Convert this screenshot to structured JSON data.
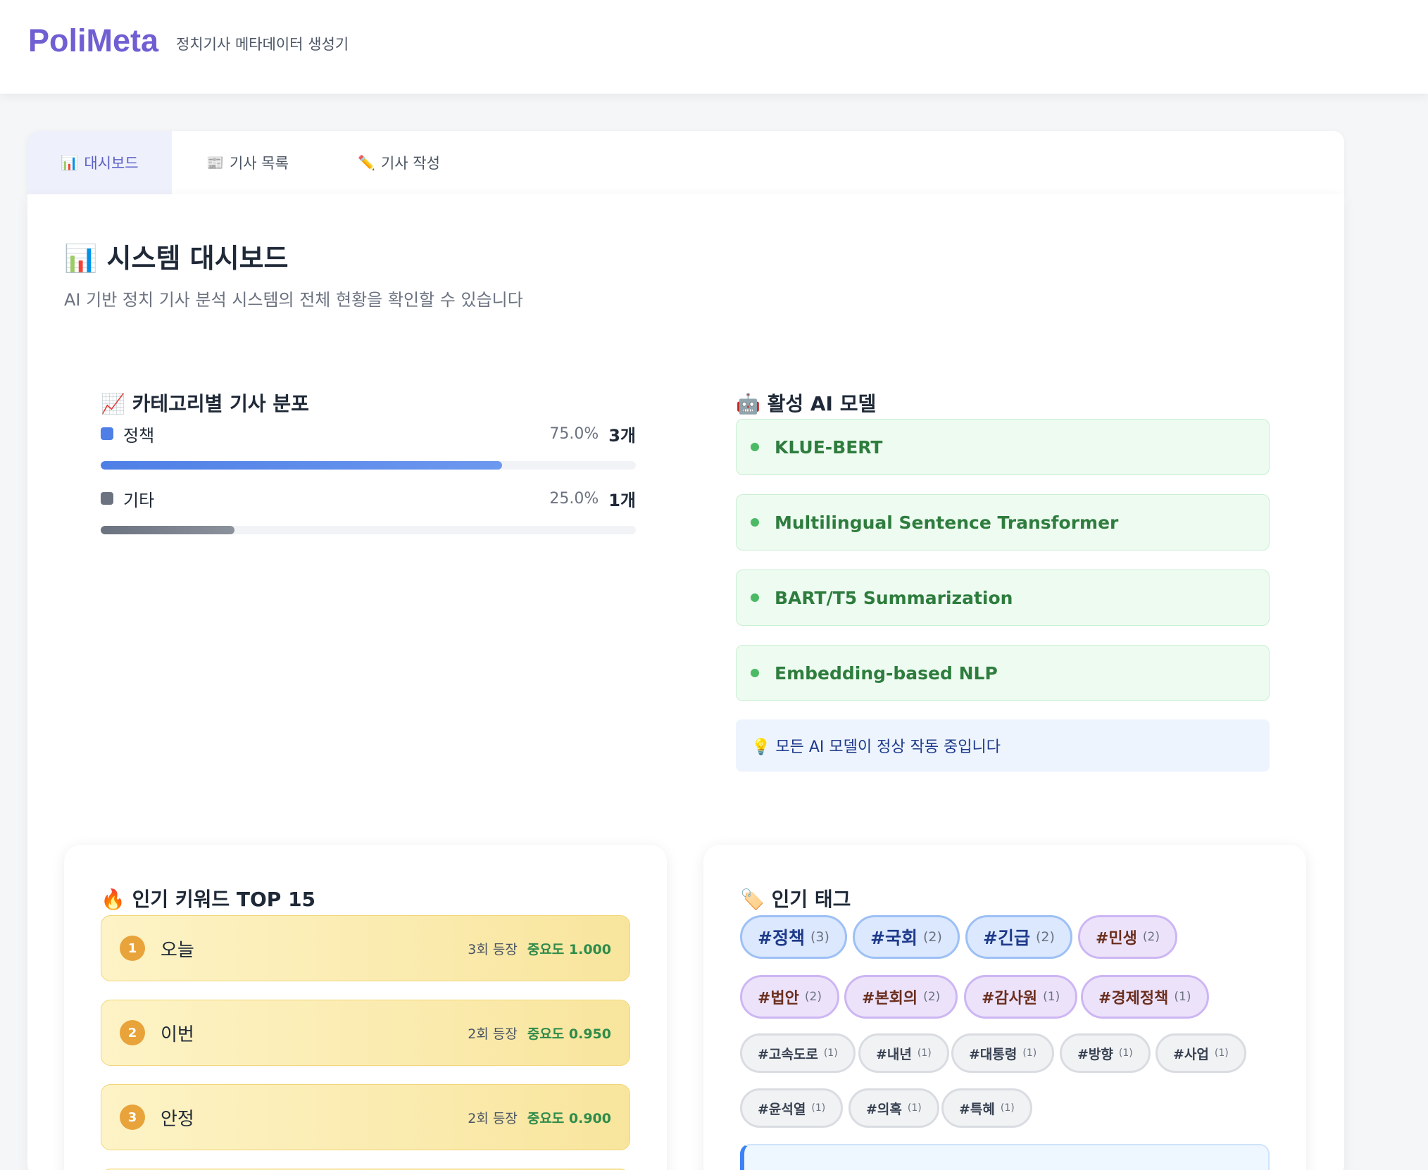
{
  "app": {
    "logo": "PoliMeta",
    "subtitle": "정치기사 메타데이터 생성기"
  },
  "tabs": [
    {
      "icon": "📊",
      "label": "대시보드",
      "active": true
    },
    {
      "icon": "📰",
      "label": "기사 목록",
      "active": false
    },
    {
      "icon": "✏️",
      "label": "기사 작성",
      "active": false
    }
  ],
  "dashboard": {
    "title": "📊 시스템 대시보드",
    "description": "AI 기반 정치 기사 분석 시스템의 전체 현황을 확인할 수 있습니다"
  },
  "category_distribution": {
    "title": "📈 카테고리별 기사 분포",
    "items": [
      {
        "name": "정책",
        "percent": "75.0%",
        "percent_value": 0.75,
        "count": "3개",
        "color": "#4e7fe6"
      },
      {
        "name": "기타",
        "percent": "25.0%",
        "percent_value": 0.25,
        "count": "1개",
        "color": "#6b7280"
      }
    ]
  },
  "ai_models": {
    "title": "🤖 활성 AI 모델",
    "items": [
      "KLUE-BERT",
      "Multilingual Sentence Transformer",
      "BART/T5 Summarization",
      "Embedding-based NLP"
    ],
    "note": "💡 모든 AI 모델이 정상 작동 중입니다"
  },
  "keywords": {
    "title": "🔥 인기 키워드 TOP 15",
    "items": [
      {
        "rank": "1",
        "word": "오늘",
        "count": "3회 등장",
        "score": "중요도 1.000"
      },
      {
        "rank": "2",
        "word": "이번",
        "count": "2회 등장",
        "score": "중요도 0.950"
      },
      {
        "rank": "3",
        "word": "안정",
        "count": "2회 등장",
        "score": "중요도 0.900"
      }
    ]
  },
  "tags": {
    "title": "🏷️ 인기 태그",
    "items": [
      {
        "name": "#정책",
        "count": "(3)",
        "style": "blue"
      },
      {
        "name": "#국회",
        "count": "(2)",
        "style": "blue"
      },
      {
        "name": "#긴급",
        "count": "(2)",
        "style": "blue"
      },
      {
        "name": "#민생",
        "count": "(2)",
        "style": "purple"
      },
      {
        "name": "#법안",
        "count": "(2)",
        "style": "purple"
      },
      {
        "name": "#본회의",
        "count": "(2)",
        "style": "purple"
      },
      {
        "name": "#감사원",
        "count": "(1)",
        "style": "purple"
      },
      {
        "name": "#경제정책",
        "count": "(1)",
        "style": "purple"
      },
      {
        "name": "#고속도로",
        "count": "(1)",
        "style": "gray"
      },
      {
        "name": "#내년",
        "count": "(1)",
        "style": "gray"
      },
      {
        "name": "#대통령",
        "count": "(1)",
        "style": "gray"
      },
      {
        "name": "#방향",
        "count": "(1)",
        "style": "gray"
      },
      {
        "name": "#사업",
        "count": "(1)",
        "style": "gray"
      },
      {
        "name": "#윤석열",
        "count": "(1)",
        "style": "gray"
      },
      {
        "name": "#의혹",
        "count": "(1)",
        "style": "gray"
      },
      {
        "name": "#특혜",
        "count": "(1)",
        "style": "gray"
      }
    ]
  }
}
